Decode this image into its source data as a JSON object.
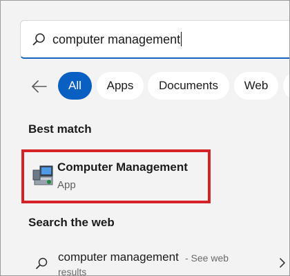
{
  "search": {
    "value": "computer management",
    "icon": "search-icon"
  },
  "filters": {
    "back_icon": "arrow-left-icon",
    "chips": [
      "All",
      "Apps",
      "Documents",
      "Web"
    ],
    "active": "All",
    "accent": "#0a5fc2"
  },
  "best_match": {
    "section_title": "Best match",
    "app_name": "Computer Management",
    "app_type": "App",
    "icon": "computer-management-icon",
    "highlight_color": "#d42227"
  },
  "web": {
    "section_title": "Search the web",
    "query": "computer management",
    "hint": "- See web",
    "hint_cont": "results",
    "icon": "search-icon",
    "chevron": "chevron-right-icon"
  }
}
